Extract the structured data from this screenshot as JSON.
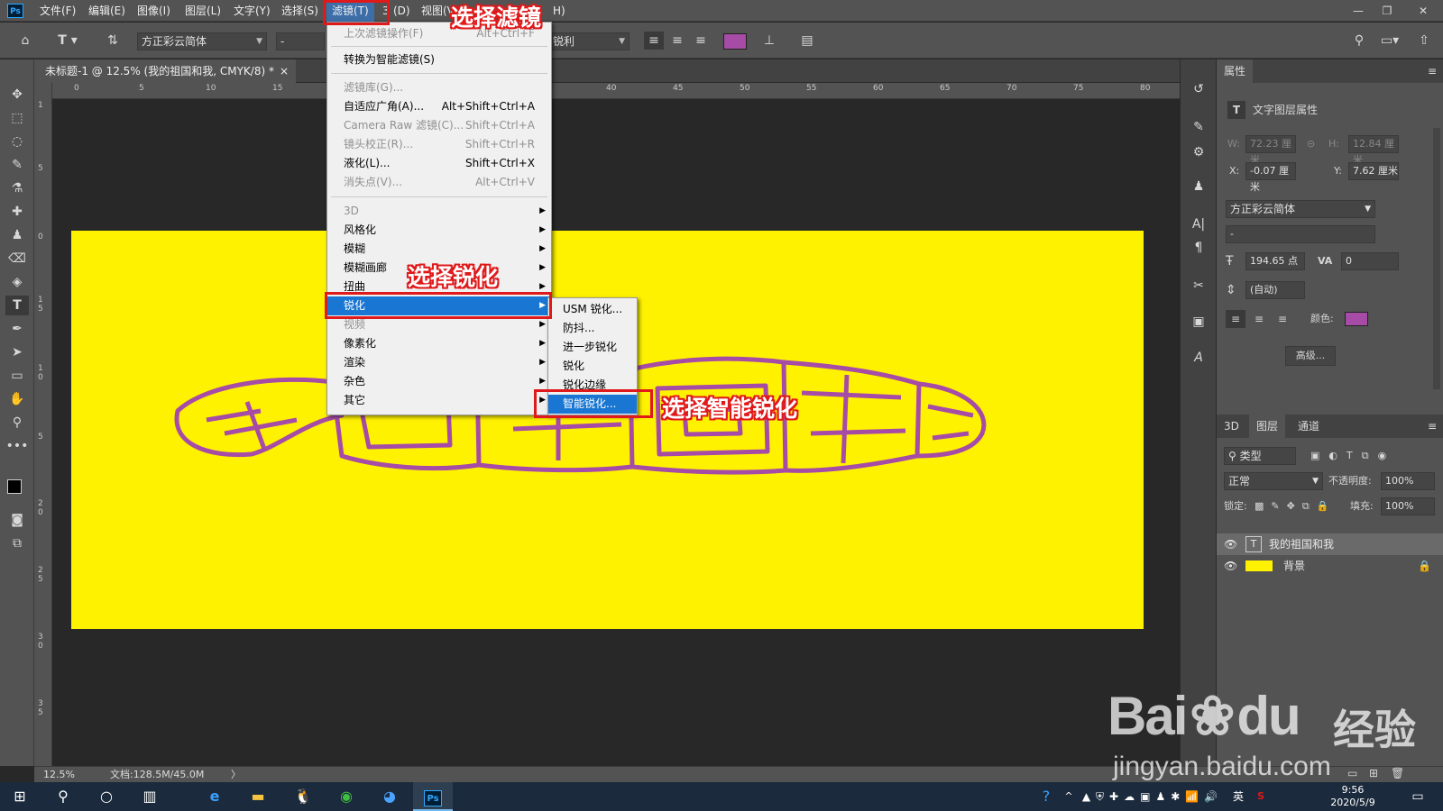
{
  "menubar": {
    "logo": "Ps",
    "items": [
      "文件(F)",
      "编辑(E)",
      "图像(I)",
      "图层(L)",
      "文字(Y)",
      "选择(S)",
      "滤镜(T)",
      "3",
      "(D)",
      "视图(V",
      "H)"
    ],
    "window_controls": [
      "—",
      "❐",
      "✕"
    ]
  },
  "options": {
    "font_family": "方正彩云简体",
    "font_style": "-",
    "antialias": "锐利",
    "text_color": "#a64ca6"
  },
  "document": {
    "tab_title": "未标题-1 @ 12.5% (我的祖国和我, CMYK/8) *",
    "tab_close": "×",
    "canvas_color": "#fff200",
    "ruler_h": [
      "0",
      "5",
      "10",
      "15",
      "40",
      "45",
      "50",
      "55",
      "60",
      "65",
      "70",
      "75",
      "80"
    ],
    "ruler_v": [
      "1",
      "5",
      "0",
      "1",
      "5",
      "1",
      "0",
      "5",
      "2",
      "0",
      "2",
      "5",
      "3",
      "0",
      "3",
      "5"
    ]
  },
  "filter_menu": {
    "items": [
      {
        "label": "上次滤镜操作(F)",
        "shortcut": "Alt+Ctrl+F",
        "disabled": true
      },
      {
        "label": "转换为智能滤镜(S)",
        "shortcut": "",
        "disabled": false
      },
      {
        "label": "滤镜库(G)...",
        "shortcut": "",
        "disabled": true
      },
      {
        "label": "自适应广角(A)...",
        "shortcut": "Alt+Shift+Ctrl+A",
        "disabled": false
      },
      {
        "label": "Camera Raw 滤镜(C)...",
        "shortcut": "Shift+Ctrl+A",
        "disabled": true
      },
      {
        "label": "镜头校正(R)...",
        "shortcut": "Shift+Ctrl+R",
        "disabled": true
      },
      {
        "label": "液化(L)...",
        "shortcut": "Shift+Ctrl+X",
        "disabled": false
      },
      {
        "label": "消失点(V)...",
        "shortcut": "Alt+Ctrl+V",
        "disabled": true
      },
      {
        "label": "3D",
        "shortcut": "",
        "disabled": true,
        "submenu": true
      },
      {
        "label": "风格化",
        "shortcut": "",
        "disabled": false,
        "submenu": true
      },
      {
        "label": "模糊",
        "shortcut": "",
        "disabled": false,
        "submenu": true
      },
      {
        "label": "模糊画廊",
        "shortcut": "",
        "disabled": false,
        "submenu": true
      },
      {
        "label": "扭曲",
        "shortcut": "",
        "disabled": false,
        "submenu": true
      },
      {
        "label": "锐化",
        "shortcut": "",
        "disabled": false,
        "submenu": true,
        "highlighted": true
      },
      {
        "label": "视频",
        "shortcut": "",
        "disabled": true,
        "submenu": true
      },
      {
        "label": "像素化",
        "shortcut": "",
        "disabled": false,
        "submenu": true
      },
      {
        "label": "渲染",
        "shortcut": "",
        "disabled": false,
        "submenu": true
      },
      {
        "label": "杂色",
        "shortcut": "",
        "disabled": false,
        "submenu": true
      },
      {
        "label": "其它",
        "shortcut": "",
        "disabled": false,
        "submenu": true
      }
    ]
  },
  "sharpen_submenu": {
    "items": [
      "USM 锐化...",
      "防抖...",
      "进一步锐化",
      "锐化",
      "锐化边缘",
      "智能锐化..."
    ],
    "highlighted_index": 5
  },
  "annotations": {
    "a1": "选择滤镜",
    "a2": "选择锐化",
    "a3": "选择智能锐化"
  },
  "properties": {
    "tab": "属性",
    "subtitle": "文字图层属性",
    "w_label": "W:",
    "w_value": "72.23 厘米",
    "h_label": "H:",
    "h_value": "12.84 厘米",
    "x_label": "X:",
    "x_value": "-0.07 厘米",
    "y_label": "Y:",
    "y_value": "7.62 厘米",
    "font": "方正彩云简体",
    "style": "-",
    "size": "194.65 点",
    "tracking": "0",
    "leading": "(自动)",
    "color_label": "颜色:",
    "color": "#a64ca6",
    "advanced": "高级..."
  },
  "layers_panel": {
    "tabs": [
      "3D",
      "图层",
      "通道"
    ],
    "filter": "类型",
    "blend": "正常",
    "opacity_label": "不透明度:",
    "opacity": "100%",
    "lock_label": "锁定:",
    "fill_label": "填充:",
    "fill": "100%",
    "layers": [
      {
        "name": "我的祖国和我",
        "type": "text"
      },
      {
        "name": "背景",
        "type": "fill",
        "color": "#fff200"
      }
    ]
  },
  "status": {
    "zoom": "12.5%",
    "doc": "文档:128.5M/45.0M",
    "arrow": "〉"
  },
  "taskbar": {
    "tray_lang": "英",
    "time": "9:56",
    "date": "2020/5/9"
  },
  "watermark": {
    "brand": "Bai",
    "brand2": "du",
    "cn": "经验",
    "url": "jingyan.baidu.com"
  }
}
